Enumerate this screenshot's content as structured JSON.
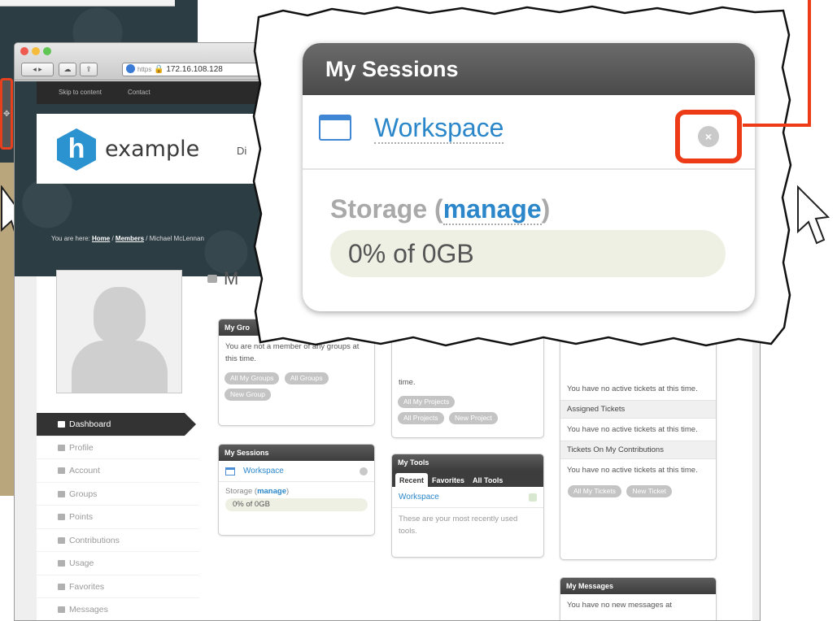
{
  "browser": {
    "url_scheme": "https",
    "url_host": "172.16.108.128"
  },
  "site": {
    "skip_link": "Skip to content",
    "contact_link": "Contact",
    "logo_letter": "h",
    "logo_text": "example",
    "nav_partial": "Di",
    "breadcrumb_prefix": "You are here:",
    "breadcrumb_home": "Home",
    "breadcrumb_sep": "/",
    "breadcrumb_members": "Members",
    "breadcrumb_user": "Michael McLennan",
    "page_heading_partial": "M"
  },
  "sidebar": {
    "items": [
      {
        "label": "Dashboard",
        "icon": "dashboard-icon",
        "active": true
      },
      {
        "label": "Profile",
        "icon": "user-icon"
      },
      {
        "label": "Account",
        "icon": "gears-icon"
      },
      {
        "label": "Groups",
        "icon": "group-icon"
      },
      {
        "label": "Points",
        "icon": "points-icon"
      },
      {
        "label": "Contributions",
        "icon": "pencil-icon"
      },
      {
        "label": "Usage",
        "icon": "chart-icon"
      },
      {
        "label": "Favorites",
        "icon": "heart-icon"
      },
      {
        "label": "Messages",
        "icon": "envelope-icon"
      }
    ]
  },
  "modules": {
    "groups": {
      "title": "My Gro",
      "text": "You are not a member of any groups at this time.",
      "buttons": [
        "All My Groups",
        "All Groups",
        "New Group"
      ]
    },
    "projects": {
      "text_tail": "time.",
      "buttons": [
        "All My Projects",
        "All Projects",
        "New Project"
      ]
    },
    "tickets": {
      "text1": "You have no active tickets at this time.",
      "assigned_header": "Assigned Tickets",
      "text2": "You have no active tickets at this time.",
      "contrib_header": "Tickets On My Contributions",
      "text3": "You have no active tickets at this time.",
      "buttons": [
        "All My Tickets",
        "New Ticket"
      ]
    },
    "sessions": {
      "title": "My Sessions",
      "workspace": "Workspace",
      "storage_label": "Storage (",
      "storage_link": "manage",
      "storage_close": ")",
      "storage_value": "0% of 0GB"
    },
    "tools": {
      "title": "My Tools",
      "tabs": [
        "Recent",
        "Favorites",
        "All Tools"
      ],
      "item": "Workspace",
      "text": "These are your most recently used tools."
    },
    "messages": {
      "title": "My Messages",
      "text": "You have no new messages at"
    }
  },
  "zoom": {
    "title": "My Sessions",
    "workspace": "Workspace",
    "close_glyph": "×",
    "storage_label": "Storage (",
    "storage_link": "manage",
    "storage_close": ")",
    "storage_value": "0% of 0GB",
    "highlight_color": "#ee3b17"
  }
}
